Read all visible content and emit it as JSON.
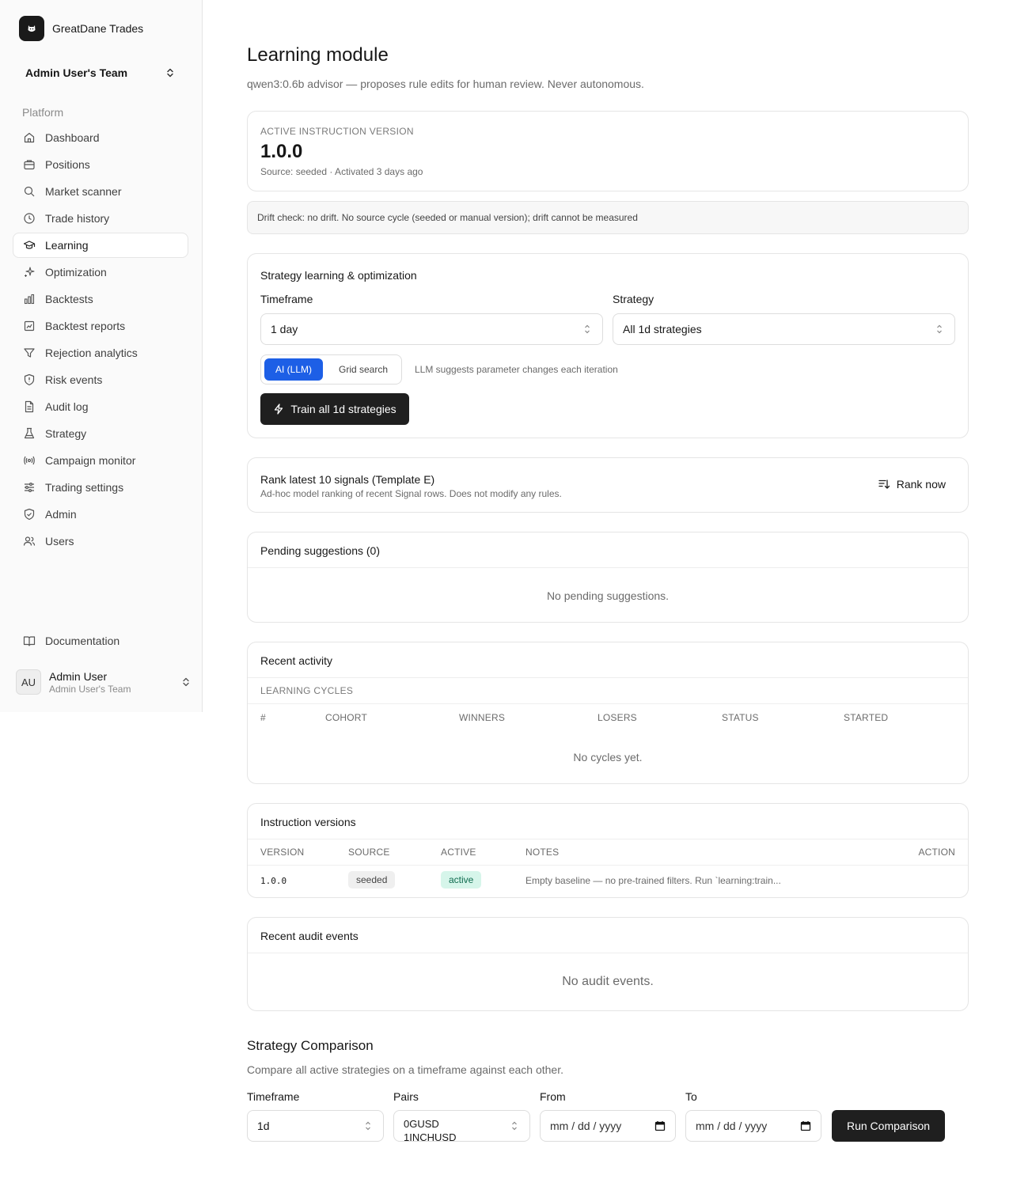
{
  "brand": {
    "name": "GreatDane Trades"
  },
  "team": {
    "name": "Admin User's Team"
  },
  "sidebar": {
    "heading": "Platform",
    "items": [
      {
        "label": "Dashboard",
        "icon": "home-icon"
      },
      {
        "label": "Positions",
        "icon": "briefcase-icon"
      },
      {
        "label": "Market scanner",
        "icon": "search-icon"
      },
      {
        "label": "Trade history",
        "icon": "clock-icon"
      },
      {
        "label": "Learning",
        "icon": "graduation-cap-icon",
        "active": true
      },
      {
        "label": "Optimization",
        "icon": "sparkles-icon"
      },
      {
        "label": "Backtests",
        "icon": "bar-chart-icon"
      },
      {
        "label": "Backtest reports",
        "icon": "report-icon"
      },
      {
        "label": "Rejection analytics",
        "icon": "filter-icon"
      },
      {
        "label": "Risk events",
        "icon": "shield-alert-icon"
      },
      {
        "label": "Audit log",
        "icon": "file-icon"
      },
      {
        "label": "Strategy",
        "icon": "flask-icon"
      },
      {
        "label": "Campaign monitor",
        "icon": "radio-icon"
      },
      {
        "label": "Trading settings",
        "icon": "sliders-icon"
      },
      {
        "label": "Admin",
        "icon": "shield-check-icon"
      },
      {
        "label": "Users",
        "icon": "users-icon"
      }
    ],
    "documentation": "Documentation"
  },
  "user": {
    "initials": "AU",
    "name": "Admin User",
    "team": "Admin User's Team"
  },
  "page": {
    "title": "Learning module",
    "subtitle": "qwen3:0.6b advisor — proposes rule edits for human review. Never autonomous."
  },
  "active_version": {
    "caption": "Active instruction version",
    "version": "1.0.0",
    "meta": "Source: seeded · Activated 3 days ago"
  },
  "drift": {
    "text": "Drift check: no drift. No source cycle (seeded or manual version); drift cannot be measured"
  },
  "optimization": {
    "title": "Strategy learning & optimization",
    "timeframe_label": "Timeframe",
    "timeframe_value": "1 day",
    "strategy_label": "Strategy",
    "strategy_value": "All 1d strategies",
    "mode_ai": "AI (LLM)",
    "mode_grid": "Grid search",
    "mode_hint": "LLM suggests parameter changes each iteration",
    "train_button": "Train all 1d strategies"
  },
  "rank": {
    "title": "Rank latest 10 signals (Template E)",
    "subtitle": "Ad-hoc model ranking of recent Signal rows. Does not modify any rules.",
    "button": "Rank now"
  },
  "pending": {
    "title": "Pending suggestions (0)",
    "empty": "No pending suggestions."
  },
  "activity": {
    "title": "Recent activity",
    "section": "Learning cycles",
    "columns": [
      "#",
      "Cohort",
      "Winners",
      "Losers",
      "Status",
      "Started"
    ],
    "empty": "No cycles yet."
  },
  "versions": {
    "title": "Instruction versions",
    "columns": [
      "Version",
      "Source",
      "Active",
      "Notes",
      "Action"
    ],
    "rows": [
      {
        "version": "1.0.0",
        "source": "seeded",
        "active": "active",
        "notes": "Empty baseline — no pre-trained filters. Run `learning:train..."
      }
    ]
  },
  "audit": {
    "title": "Recent audit events",
    "empty": "No audit events."
  },
  "comparison": {
    "title": "Strategy Comparison",
    "subtitle": "Compare all active strategies on a timeframe against each other.",
    "timeframe_label": "Timeframe",
    "timeframe_value": "1d",
    "pairs_label": "Pairs",
    "pairs_values": [
      "0GUSD",
      "1INCHUSD"
    ],
    "from_label": "From",
    "to_label": "To",
    "date_placeholder": "mm / dd / yyyy",
    "run_button": "Run Comparison"
  },
  "colors": {
    "accent": "#1d5fe6",
    "dark": "#1f1f1f",
    "active_pill_bg": "#d6f5ea",
    "active_pill_fg": "#0f6b4f"
  }
}
